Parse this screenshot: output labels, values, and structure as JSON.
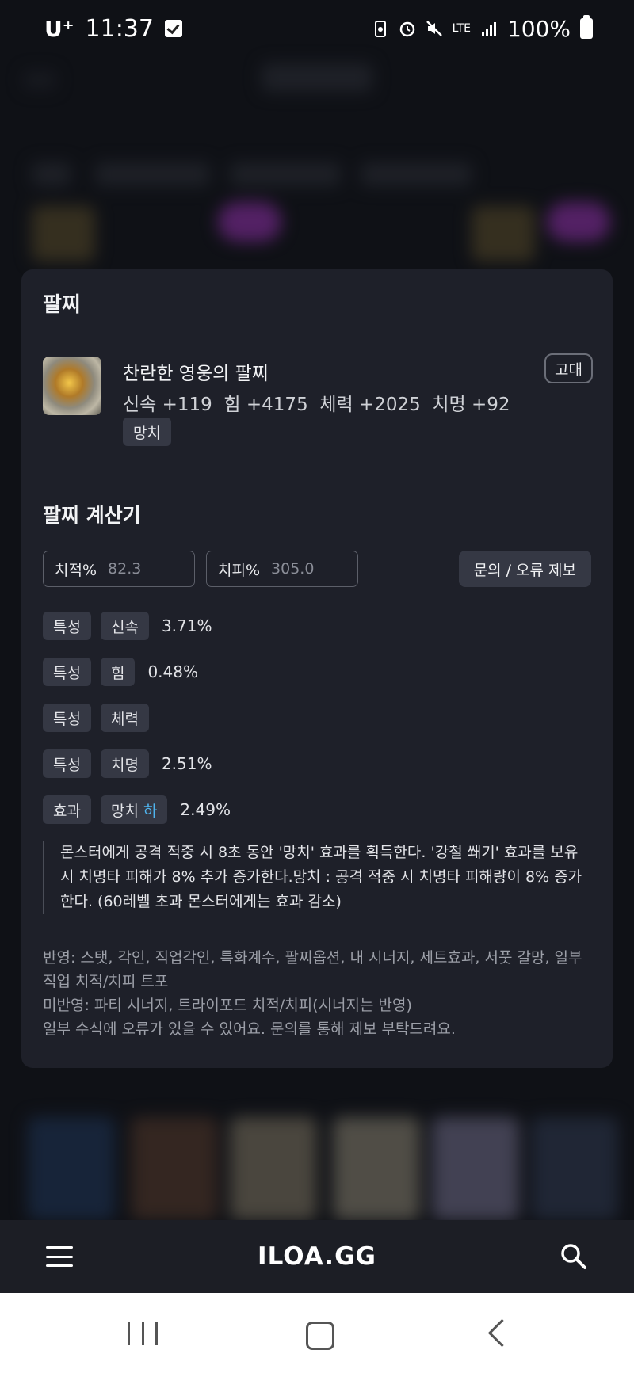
{
  "status_bar": {
    "carrier": "U⁺",
    "time": "11:37",
    "network": "LTE",
    "battery": "100%"
  },
  "modal": {
    "title": "팔찌",
    "item": {
      "name": "찬란한 영웅의 팔찌",
      "stats": "신속 +119  힘 +4175  체력 +2025  치명 +92",
      "tag": "망치",
      "grade": "고대"
    },
    "calculator": {
      "title": "팔찌 계산기",
      "crit_rate": {
        "label": "치적%",
        "value": "82.3"
      },
      "crit_dmg": {
        "label": "치피%",
        "value": "305.0"
      },
      "report_button": "문의 / 오류 제보",
      "options": [
        {
          "type": "특성",
          "name": "신속",
          "value": "3.71%"
        },
        {
          "type": "특성",
          "name": "힘",
          "value": "0.48%"
        },
        {
          "type": "특성",
          "name": "체력",
          "value": ""
        },
        {
          "type": "특성",
          "name": "치명",
          "value": "2.51%"
        }
      ],
      "effect": {
        "type": "효과",
        "name": "망치",
        "grade": "하",
        "value": "2.49%"
      },
      "description": "몬스터에게 공격 적중 시 8초 동안 '망치' 효과를 획득한다. '강철 쐐기' 효과를 보유 시 치명타 피해가 8% 추가 증가한다.망치 : 공격 적중 시 치명타 피해량이 8% 증가한다. (60레벨 초과 몬스터에게는 효과 감소)",
      "notes": {
        "line1": "반영: 스탯, 각인, 직업각인, 특화계수, 팔찌옵션, 내 시너지, 세트효과, 서풋 갈망, 일부 직업 치적/치피 트포",
        "line2": "미반영: 파티 시너지, 트라이포드 치적/치피(시너지는 반영)",
        "line3": "일부 수식에 오류가 있을 수 있어요. 문의를 통해 제보 부탁드려요."
      }
    }
  },
  "app_bar": {
    "brand": "ILOA.GG"
  },
  "colors": {
    "accent_grade_low": "#4fb4ee",
    "modal_bg": "#1e2029",
    "chip_bg": "#353844"
  }
}
